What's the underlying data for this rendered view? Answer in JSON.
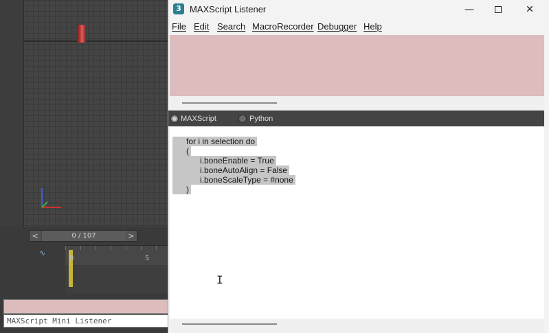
{
  "window": {
    "title": "MAXScript Listener",
    "app_icon": "3",
    "minimize": "—",
    "close": "✕"
  },
  "menu": [
    {
      "label": "File"
    },
    {
      "label": "Edit"
    },
    {
      "label": "Search"
    },
    {
      "label": "MacroRecorder"
    },
    {
      "label": "Debugger"
    },
    {
      "label": "Help"
    }
  ],
  "languages": {
    "maxscript": "MAXScript",
    "python": "Python",
    "selected": "maxscript"
  },
  "editor": {
    "lines": [
      "      for i in selection do ",
      "      ( ",
      "            i.boneEnable = True ",
      "            i.boneAutoAlign = False ",
      "            i.boneScaleType = #none ",
      "      ) "
    ]
  },
  "timeline": {
    "prev": "<",
    "next": ">",
    "frame_readout": "0 / 107",
    "tick_0": "0",
    "tick_5": "5",
    "curve_icon": "∿"
  },
  "mini_listener": {
    "placeholder": "MAXScript Mini Listener"
  },
  "colors": {
    "output_pane": "#dcbcbc",
    "selection": "#c6c6c6",
    "object": "#c03c3c"
  },
  "icons": {
    "cursor": "I"
  }
}
